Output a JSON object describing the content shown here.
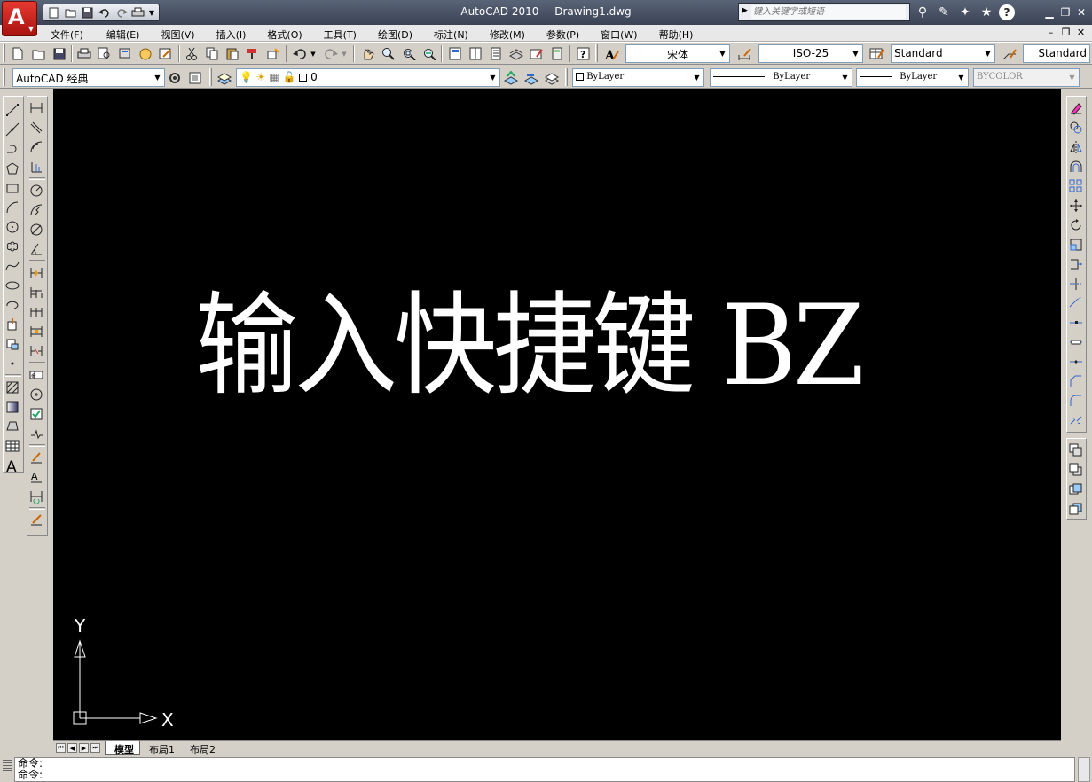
{
  "titlebar": {
    "app_name": "AutoCAD 2010",
    "doc_name": "Drawing1.dwg",
    "logo_letter": "A",
    "search_placeholder": "键入关键字或短语",
    "accent": "#d6231b"
  },
  "quick_access": [
    "new-icon",
    "open-icon",
    "save-icon",
    "undo-icon",
    "redo-icon",
    "plot-icon"
  ],
  "menu": [
    "文件(F)",
    "编辑(E)",
    "视图(V)",
    "插入(I)",
    "格式(O)",
    "工具(T)",
    "绘图(D)",
    "标注(N)",
    "修改(M)",
    "参数(P)",
    "窗口(W)",
    "帮助(H)"
  ],
  "styles": {
    "text_style_font": "宋体",
    "dim_style": "ISO-25",
    "table_style": "Standard",
    "multileader_style": "Standard"
  },
  "workspace": {
    "name": "AutoCAD 经典"
  },
  "layer": {
    "current": "0"
  },
  "properties": {
    "color": "ByLayer",
    "linetype": "ByLayer",
    "lineweight": "ByLayer",
    "plot_style": "BYCOLOR"
  },
  "canvas": {
    "mtext": "输入快捷键 BZ",
    "background": "#000000",
    "ucs_x_label": "X",
    "ucs_y_label": "Y"
  },
  "layout_tabs": {
    "tabs": [
      "模型",
      "布局1",
      "布局2"
    ],
    "active": "模型"
  },
  "command_line": {
    "lines": [
      "命令:",
      "命令:"
    ]
  }
}
